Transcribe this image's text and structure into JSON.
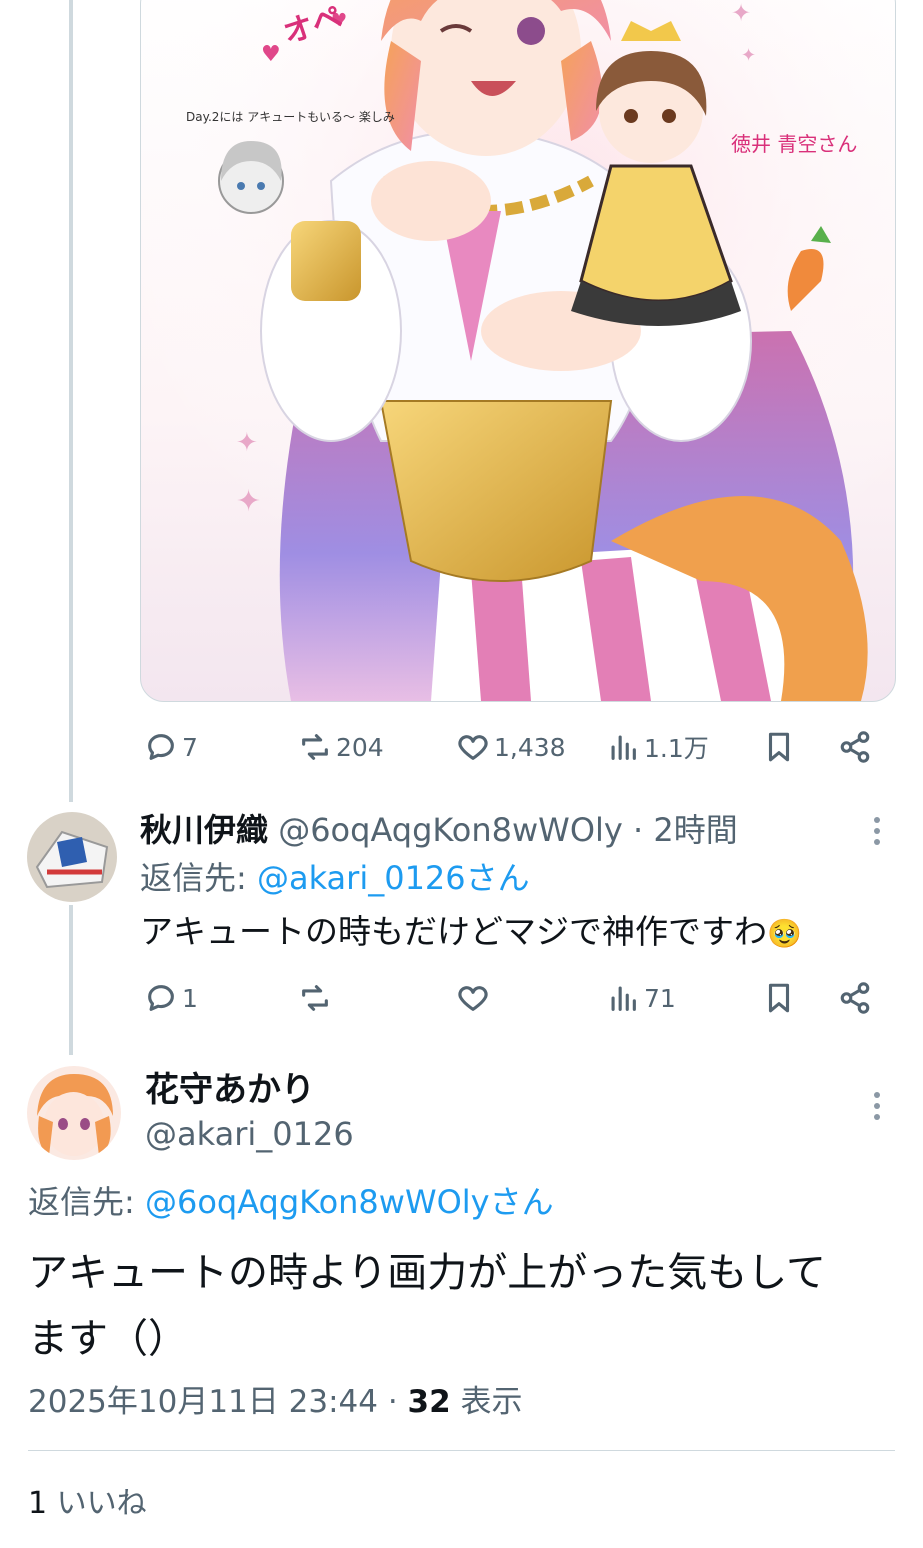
{
  "main_post": {
    "metrics": {
      "replies": "7",
      "reposts": "204",
      "likes": "1,438",
      "views": "1.1万"
    },
    "image": {
      "handwritten_notes": [
        "オペ",
        "Day.2には アキュートもいる〜 楽しみ",
        "徳井 青空さん"
      ]
    }
  },
  "reply_1": {
    "display_name": "秋川伊織",
    "handle": "@6oqAqgKon8wWOly",
    "time": "· 2時間",
    "reply_label": "返信先: ",
    "reply_target": "@akari_0126さん",
    "text": "アキュートの時もだけどマジで神作ですわ",
    "emoji": "🥹",
    "metrics": {
      "replies": "1",
      "reposts": "",
      "likes": "",
      "views": "71"
    }
  },
  "focal_post": {
    "display_name": "花守あかり",
    "handle": "@akari_0126",
    "reply_label": "返信先: ",
    "reply_target": "@6oqAqgKon8wWOlyさん",
    "text_line1": "アキュートの時より画力が上がった気もして",
    "text_line2": "ます（）",
    "timestamp": "2025年10月11日 23:44 · ",
    "view_count": "32",
    "view_label": " 表示",
    "likes_count": "1",
    "likes_label": " いいね"
  },
  "colors": {
    "accent": "#1d9bf0",
    "secondary_text": "#536471",
    "divider": "#cfd9de"
  }
}
